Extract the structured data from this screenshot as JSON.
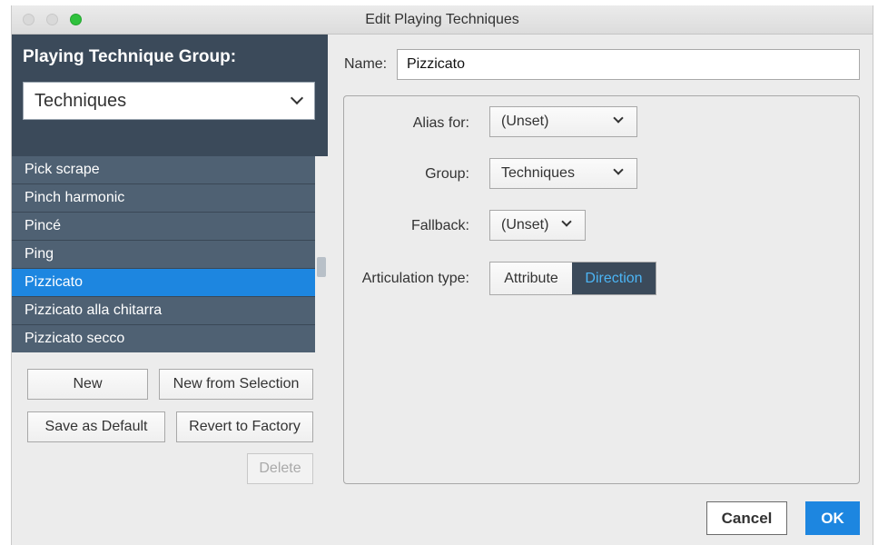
{
  "window": {
    "title": "Edit Playing Techniques"
  },
  "group": {
    "label": "Playing Technique Group:",
    "selected": "Techniques"
  },
  "techniques": {
    "items": [
      "Pick scrape",
      "Pinch harmonic",
      "Pincé",
      "Ping",
      "Pizzicato",
      "Pizzicato alla chitarra",
      "Pizzicato secco"
    ],
    "selected": "Pizzicato"
  },
  "left_buttons": {
    "new": "New",
    "new_from_selection": "New from Selection",
    "save_as_default": "Save as Default",
    "revert_to_factory": "Revert to Factory",
    "delete": "Delete"
  },
  "name": {
    "label": "Name:",
    "value": "Pizzicato"
  },
  "properties": {
    "alias_label": "Alias for:",
    "alias_value": "(Unset)",
    "group_label": "Group:",
    "group_value": "Techniques",
    "fallback_label": "Fallback:",
    "fallback_value": "(Unset)",
    "articulation_label": "Articulation type:",
    "articulation_options": [
      "Attribute",
      "Direction"
    ],
    "articulation_selected": "Direction"
  },
  "footer": {
    "cancel": "Cancel",
    "ok": "OK"
  },
  "colors": {
    "accent": "#1d86e0",
    "panel_dark": "#3b4a5a",
    "selected_segment_text": "#4cb5f5",
    "maximize_button": "#2fc13d"
  },
  "icons": {
    "dropdown": "chevron-down-icon"
  }
}
